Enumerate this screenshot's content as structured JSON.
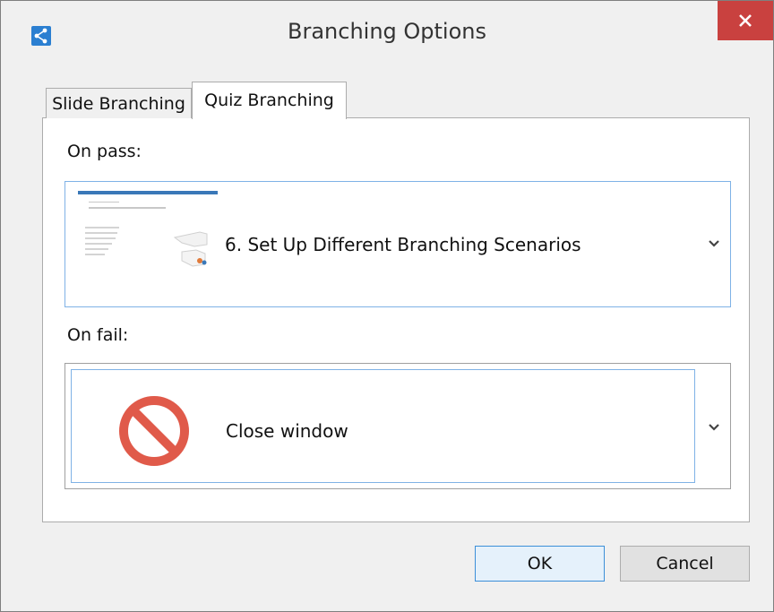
{
  "window": {
    "title": "Branching Options",
    "icon": "branch-share-icon",
    "close_icon": "close-icon"
  },
  "tabs": [
    {
      "label": "Slide Branching",
      "active": false
    },
    {
      "label": "Quiz Branching",
      "active": true
    }
  ],
  "on_pass": {
    "label": "On pass:",
    "selected": "6. Set Up Different Branching Scenarios",
    "thumbnail": "slide-thumbnail"
  },
  "on_fail": {
    "label": "On fail:",
    "selected": "Close window",
    "icon": "no-entry-icon"
  },
  "buttons": {
    "ok": "OK",
    "cancel": "Cancel"
  },
  "colors": {
    "close_button": "#c9413f",
    "focus_border": "#7fb2e6",
    "no_icon": "#e05a4a"
  }
}
